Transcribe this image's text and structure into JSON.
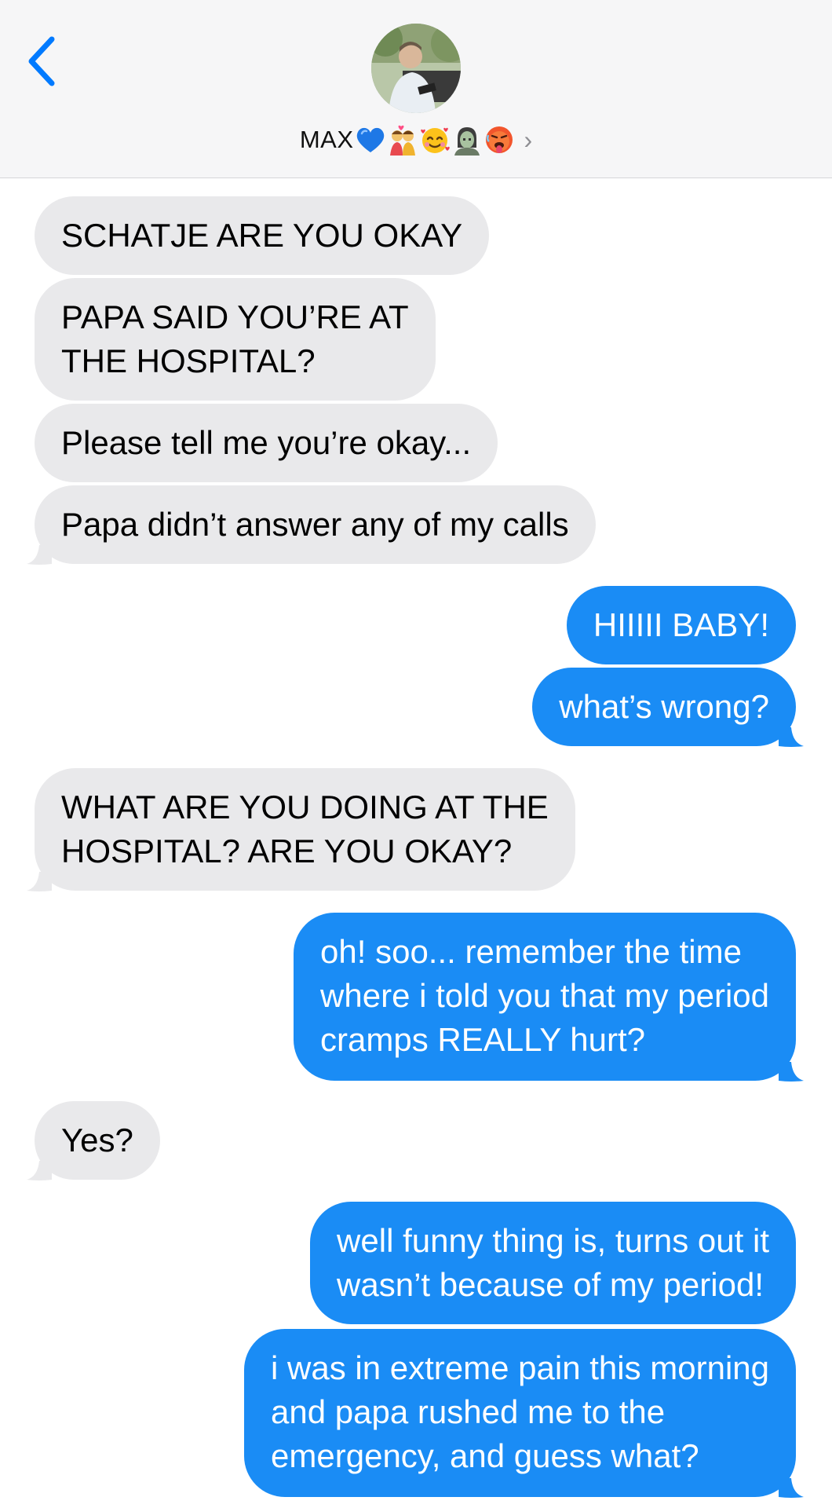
{
  "header": {
    "contact_name": "MAX",
    "emojis": [
      "blue-heart",
      "couple-kiss",
      "smiling-face-with-hearts",
      "zombie",
      "hot-face"
    ],
    "chevron": "›"
  },
  "messages": [
    {
      "dir": "received",
      "text": "SCHATJE ARE YOU OKAY"
    },
    {
      "dir": "received",
      "text": "PAPA SAID YOU’RE AT\nTHE HOSPITAL?"
    },
    {
      "dir": "received",
      "text": "Please tell me you’re okay..."
    },
    {
      "dir": "received",
      "text": "Papa didn’t answer any of my calls"
    },
    {
      "dir": "sent",
      "text": "HIIIII BABY!"
    },
    {
      "dir": "sent",
      "text": "what’s wrong?"
    },
    {
      "dir": "received",
      "text": "WHAT ARE YOU DOING AT THE\nHOSPITAL? ARE YOU OKAY?"
    },
    {
      "dir": "sent",
      "text": "oh! soo... remember the time\nwhere i told you that my period\ncramps REALLY hurt?"
    },
    {
      "dir": "received",
      "text": "Yes?"
    },
    {
      "dir": "sent",
      "text": "well funny thing is, turns out it\nwasn’t because of my period!"
    },
    {
      "dir": "sent",
      "text": "i was in extreme pain this morning\nand papa rushed me to the\nemergency, and guess what?"
    }
  ],
  "colors": {
    "received_bubble": "#e9e9eb",
    "sent_bubble": "#1a8cf5",
    "accent": "#007aff"
  }
}
